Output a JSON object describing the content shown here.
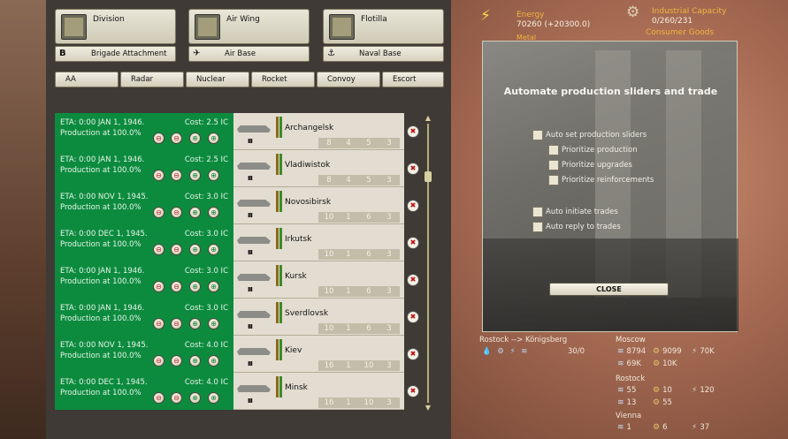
{
  "unit_types": [
    {
      "label": "Division",
      "sub_icon": "B",
      "sub_label": "Brigade Attachment"
    },
    {
      "label": "Air Wing",
      "sub_icon": "✈",
      "sub_label": "Air Base"
    },
    {
      "label": "Flotilla",
      "sub_icon": "⚓",
      "sub_label": "Naval Base"
    }
  ],
  "attachments": [
    "AA",
    "Radar",
    "Nuclear",
    "Rocket",
    "Convoy",
    "Escort"
  ],
  "queue": [
    {
      "eta": "ETA: 0:00 JAN 1, 1946.",
      "cost": "Cost: 2.5 IC",
      "prod": "Production at 100.0%",
      "name": "Archangelsk",
      "stats": [
        "8",
        "4",
        "5",
        "3"
      ]
    },
    {
      "eta": "ETA: 0:00 JAN 1, 1946.",
      "cost": "Cost: 2.5 IC",
      "prod": "Production at 100.0%",
      "name": "Vladiwistok",
      "stats": [
        "8",
        "4",
        "5",
        "3"
      ]
    },
    {
      "eta": "ETA: 0:00 NOV 1, 1945.",
      "cost": "Cost: 3.0 IC",
      "prod": "Production at 100.0%",
      "name": "Novosibirsk",
      "stats": [
        "10",
        "1",
        "6",
        "3"
      ]
    },
    {
      "eta": "ETA: 0:00 DEC 1, 1945.",
      "cost": "Cost: 3.0 IC",
      "prod": "Production at 100.0%",
      "name": "Irkutsk",
      "stats": [
        "10",
        "1",
        "6",
        "3"
      ]
    },
    {
      "eta": "ETA: 0:00 JAN 1, 1946.",
      "cost": "Cost: 3.0 IC",
      "prod": "Production at 100.0%",
      "name": "Kursk",
      "stats": [
        "10",
        "1",
        "6",
        "3"
      ]
    },
    {
      "eta": "ETA: 0:00 JAN 1, 1946.",
      "cost": "Cost: 3.0 IC",
      "prod": "Production at 100.0%",
      "name": "Sverdlovsk",
      "stats": [
        "10",
        "1",
        "6",
        "3"
      ]
    },
    {
      "eta": "ETA: 0:00 NOV 1, 1945.",
      "cost": "Cost: 4.0 IC",
      "prod": "Production at 100.0%",
      "name": "Kiev",
      "stats": [
        "16",
        "1",
        "10",
        "3"
      ]
    },
    {
      "eta": "ETA: 0:00 DEC 1, 1945.",
      "cost": "Cost: 4.0 IC",
      "prod": "Production at 100.0%",
      "name": "Minsk",
      "stats": [
        "16",
        "1",
        "10",
        "3"
      ]
    }
  ],
  "ship_mark": "III",
  "resources": {
    "energy_label": "Energy",
    "energy_value": "70260 (+20300.0)",
    "ic_label": "Industrial Capacity",
    "ic_value": "0/260/231",
    "consumer_label": "Consumer Goods",
    "metal_label": "Metal"
  },
  "automate": {
    "title": "Automate production sliders and trade",
    "options": [
      "Auto set production sliders",
      "Prioritize production",
      "Prioritize upgrades",
      "Prioritize reinforcements",
      "Auto initiate trades",
      "Auto reply to trades"
    ],
    "close_label": "CLOSE"
  },
  "trade": {
    "route": "Rostock --> Königsberg",
    "value": "30/0"
  },
  "cities": [
    {
      "name": "Moscow",
      "rows": [
        [
          "8794",
          "9099",
          "70K"
        ],
        [
          "69K",
          "10K",
          ""
        ]
      ]
    },
    {
      "name": "Rostock",
      "rows": [
        [
          "55",
          "10",
          "120"
        ],
        [
          "13",
          "55",
          ""
        ]
      ]
    },
    {
      "name": "Vienna",
      "rows": [
        [
          "1",
          "6",
          "37"
        ]
      ]
    }
  ],
  "controls": [
    "⊖",
    "⊖",
    "⊕",
    "⊕"
  ]
}
